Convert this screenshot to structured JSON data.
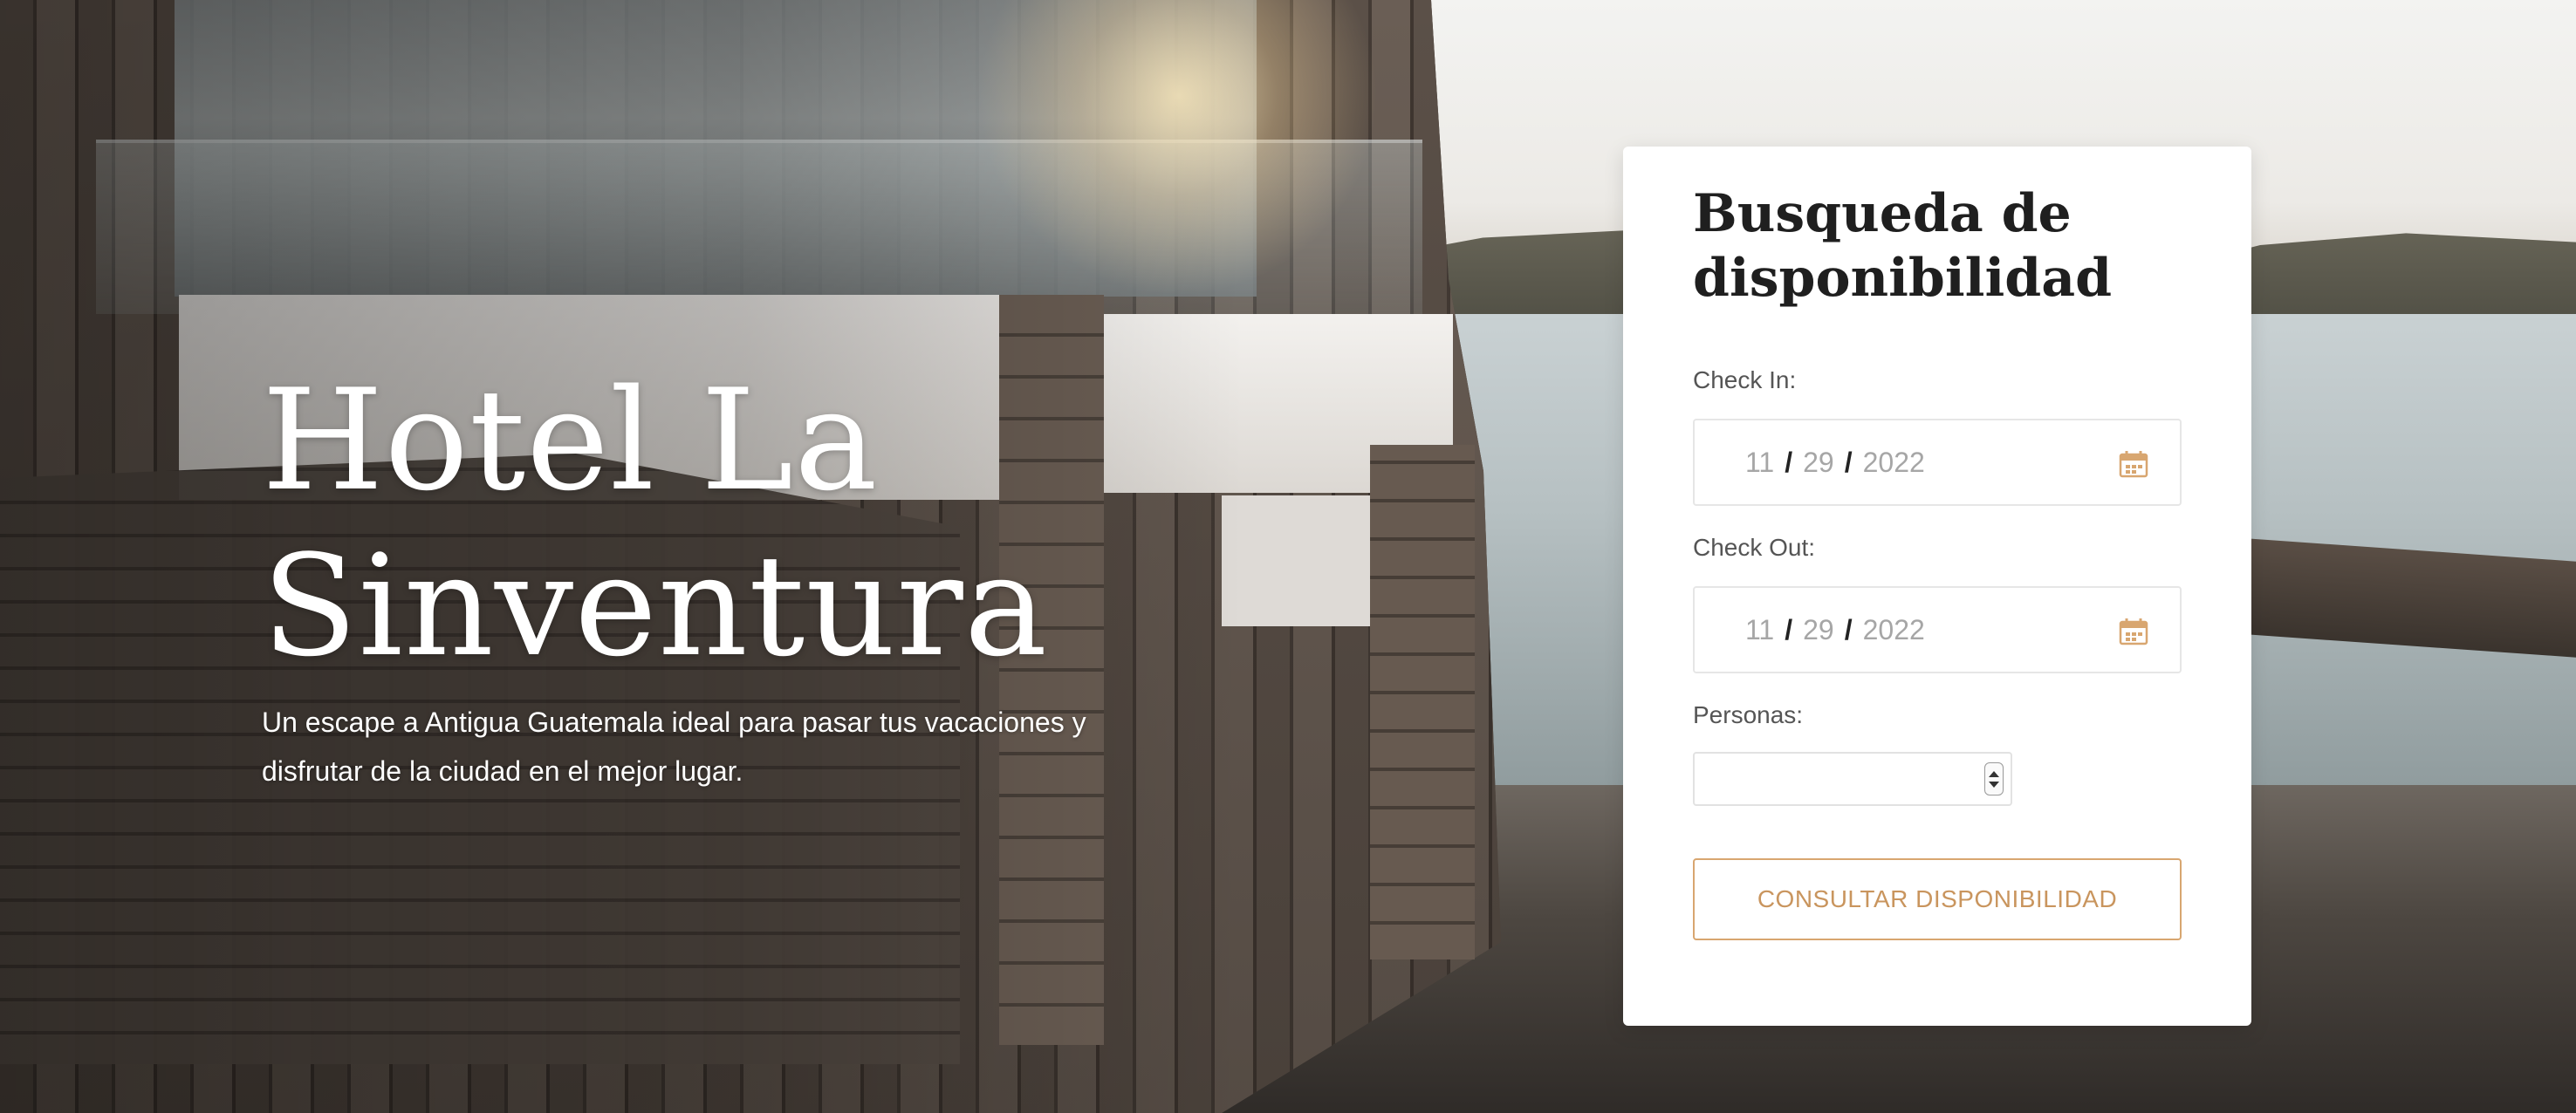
{
  "hero": {
    "title_line1": "Hotel La",
    "title_line2": "Sinventura",
    "subtitle": "Un escape a Antigua Guatemala ideal para pasar tus vacaciones y disfrutar de la ciudad en el mejor lugar."
  },
  "search": {
    "title_line1": "Busqueda de",
    "title_line2": "disponibilidad",
    "check_in": {
      "label": "Check In:",
      "month": "11",
      "day": "29",
      "year": "2022",
      "separator": "/",
      "icon": "calendar-icon"
    },
    "check_out": {
      "label": "Check Out:",
      "month": "11",
      "day": "29",
      "year": "2022",
      "separator": "/",
      "icon": "calendar-icon"
    },
    "persons": {
      "label": "Personas:",
      "value": ""
    },
    "submit_label": "CONSULTAR DISPONIBILIDAD"
  },
  "colors": {
    "accent": "#d8a670",
    "accent_text": "#c9955e",
    "card_bg": "#ffffff",
    "hero_text": "#ffffff"
  }
}
